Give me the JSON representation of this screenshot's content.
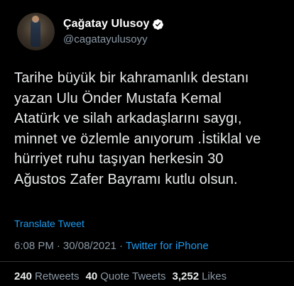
{
  "author": {
    "display_name": "Çağatay Ulusoy",
    "handle": "@cagatayulusoyy",
    "verified": true
  },
  "tweet": {
    "text": "Tarihe büyük bir kahramanlık destanı\nyazan Ulu Önder Mustafa Kemal\nAtatürk ve silah arkadaşlarını  saygı,\nminnet ve özlemle anıyorum .İstiklal ve\nhürriyet ruhu taşıyan herkesin 30\nAğustos Zafer Bayramı kutlu olsun.",
    "translate_label": "Translate Tweet",
    "time": "6:08 PM",
    "date": "30/08/2021",
    "separator": "·",
    "source": "Twitter for iPhone"
  },
  "stats": {
    "retweets_count": "240",
    "retweets_label": "Retweets",
    "quotes_count": "40",
    "quotes_label": "Quote Tweets",
    "likes_count": "3,252",
    "likes_label": "Likes"
  },
  "colors": {
    "background": "#000000",
    "text": "#e7e9ea",
    "secondary": "#8b98a5",
    "accent": "#1d9bf0"
  },
  "icons": {
    "verified": "verified-badge-icon"
  }
}
